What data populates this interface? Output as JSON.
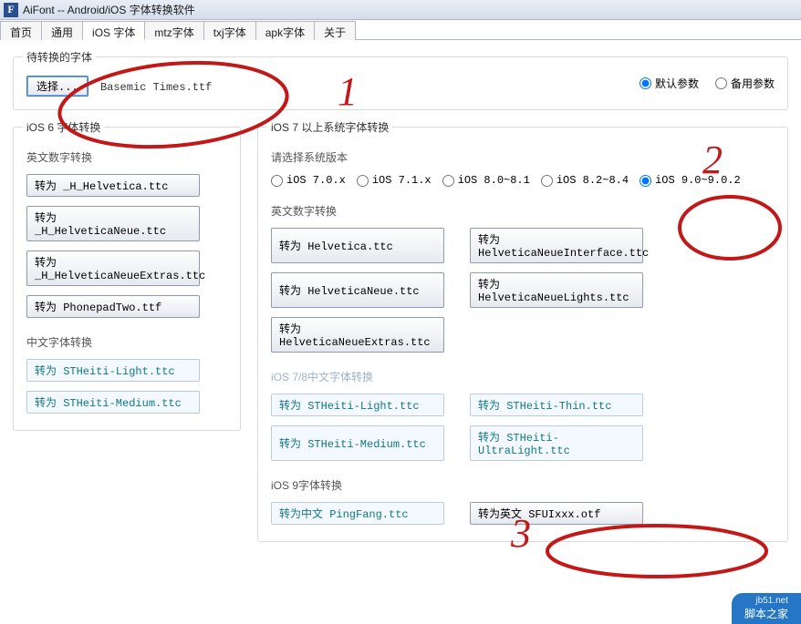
{
  "titlebar": {
    "icon_letter": "F",
    "title": "AiFont -- Android/iOS 字体转换软件"
  },
  "tabs": [
    {
      "label": "首页",
      "active": false
    },
    {
      "label": "通用",
      "active": false
    },
    {
      "label": "iOS 字体",
      "active": true
    },
    {
      "label": "mtz字体",
      "active": false
    },
    {
      "label": "txj字体",
      "active": false
    },
    {
      "label": "apk字体",
      "active": false
    },
    {
      "label": "关于",
      "active": false
    }
  ],
  "source": {
    "legend": "待转换的字体",
    "button": "选择...",
    "filename": "Basemic Times.ttf",
    "param_options": {
      "default": "默认参数",
      "backup": "备用参数"
    }
  },
  "ios6": {
    "legend": "iOS 6 字体转换",
    "en_title": "英文数字转换",
    "en_buttons": [
      "转为 _H_Helvetica.ttc",
      "转为 _H_HelveticaNeue.ttc",
      "转为 _H_HelveticaNeueExtras.ttc",
      "转为 PhonepadTwo.ttf"
    ],
    "cn_title": "中文字体转换",
    "cn_buttons": [
      "转为 STHeiti-Light.ttc",
      "转为 STHeiti-Medium.ttc"
    ]
  },
  "ios7": {
    "legend": "iOS 7 以上系统字体转换",
    "version_title": "请选择系统版本",
    "versions": [
      "iOS 7.0.x",
      "iOS 7.1.x",
      "iOS 8.0~8.1",
      "iOS 8.2~8.4",
      "iOS 9.0~9.0.2"
    ],
    "en_title": "英文数字转换",
    "en_rows": [
      [
        "转为 Helvetica.ttc",
        "转为 HelveticaNeueInterface.ttc"
      ],
      [
        "转为 HelveticaNeue.ttc",
        "转为 HelveticaNeueLights.ttc"
      ],
      [
        "转为 HelveticaNeueExtras.ttc"
      ]
    ],
    "cn78_title": "iOS 7/8中文字体转换",
    "cn78_rows": [
      [
        "转为 STHeiti-Light.ttc",
        "转为 STHeiti-Thin.ttc"
      ],
      [
        "转为 STHeiti-Medium.ttc",
        "转为 STHeiti-UltraLight.ttc"
      ]
    ],
    "cn9_title": "iOS 9字体转换",
    "cn9_rows": [
      [
        "转为中文 PingFang.ttc",
        "转为英文 SFUIxxx.otf"
      ]
    ]
  },
  "annotations": {
    "1": "1",
    "2": "2",
    "3": "3"
  },
  "watermark": {
    "site": "脚本之家",
    "domain": "jb51.net"
  }
}
